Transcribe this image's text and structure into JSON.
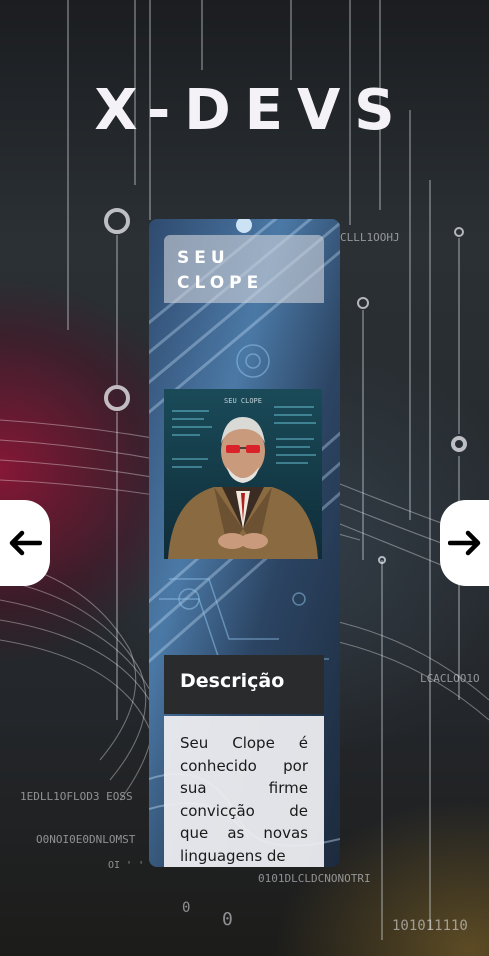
{
  "header": {
    "title": "X-DEVS"
  },
  "carousel": {
    "prev_icon": "arrow-left-icon",
    "next_icon": "arrow-right-icon",
    "card": {
      "name": "SEU CLOPE",
      "portrait_icon": "character-portrait",
      "portrait_caption": "SEU CLOPE",
      "description_title": "Descrição",
      "description_text": "Seu Clope é conhecido por sua firme convicção de que as novas linguagens de"
    }
  },
  "colors": {
    "background_dark": "#23262a",
    "accent_crimson": "#8c1432",
    "card_blue": "#3f6a96",
    "button_white": "#ffffff",
    "text_light": "#f4f2f6"
  }
}
